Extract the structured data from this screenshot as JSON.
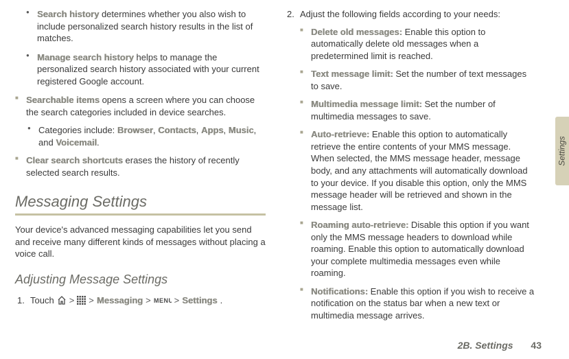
{
  "left": {
    "items": [
      {
        "bold": "Search history",
        "text": " determines whether you also wish to include personalized search history results in the list of matches."
      },
      {
        "bold": "Manage search history",
        "text": " helps to manage the personalized search history associated with your current registered Google account."
      }
    ],
    "searchable": {
      "bold": "Searchable items",
      "text": " opens a screen where you can choose the search categories included in device searches.",
      "cat_prefix": "Categories include: ",
      "cats": [
        "Browser",
        "Contacts",
        "Apps",
        "Music",
        "Voicemail"
      ],
      "cat_and": ", and ",
      "cat_sep": ", ",
      "cat_end": "."
    },
    "clear": {
      "bold": "Clear search shortcuts",
      "text": " erases the history of recently selected search results."
    },
    "h2": "Messaging Settings",
    "intro": "Your device's advanced messaging capabilities let you send and receive many different kinds of messages without placing a voice call.",
    "h3": "Adjusting Message Settings",
    "step1_num": "1.",
    "step1_prefix": "Touch ",
    "path": {
      "m1": "Messaging",
      "m2": "Settings"
    }
  },
  "right": {
    "step2_num": "2.",
    "step2_text": "Adjust the following fields according to your needs:",
    "items": [
      {
        "bold": "Delete old messages:",
        "text": " Enable this option to automatically delete old messages when a predetermined limit is reached."
      },
      {
        "bold": "Text message limit:",
        "text": " Set the number of text messages to save."
      },
      {
        "bold": "Multimedia message limit:",
        "text": " Set the number of multimedia messages to save."
      },
      {
        "bold": "Auto-retrieve:",
        "text": " Enable this option to automatically retrieve the entire contents of your MMS message. When selected, the MMS message header, message body, and any attachments will automatically download to your device. If you disable this option, only the MMS message header will be retrieved and shown in the message list."
      },
      {
        "bold": "Roaming auto-retrieve:",
        "text": " Disable this option if you want only the MMS message headers to download while roaming. Enable this option to automatically download your complete multimedia messages even while roaming."
      },
      {
        "bold": "Notifications:",
        "text": " Enable this option if you wish to receive a notification on the status bar when a new text or multimedia message arrives."
      }
    ]
  },
  "footer": {
    "section": "2B. Settings",
    "page": "43"
  },
  "sidetab": "Settings"
}
